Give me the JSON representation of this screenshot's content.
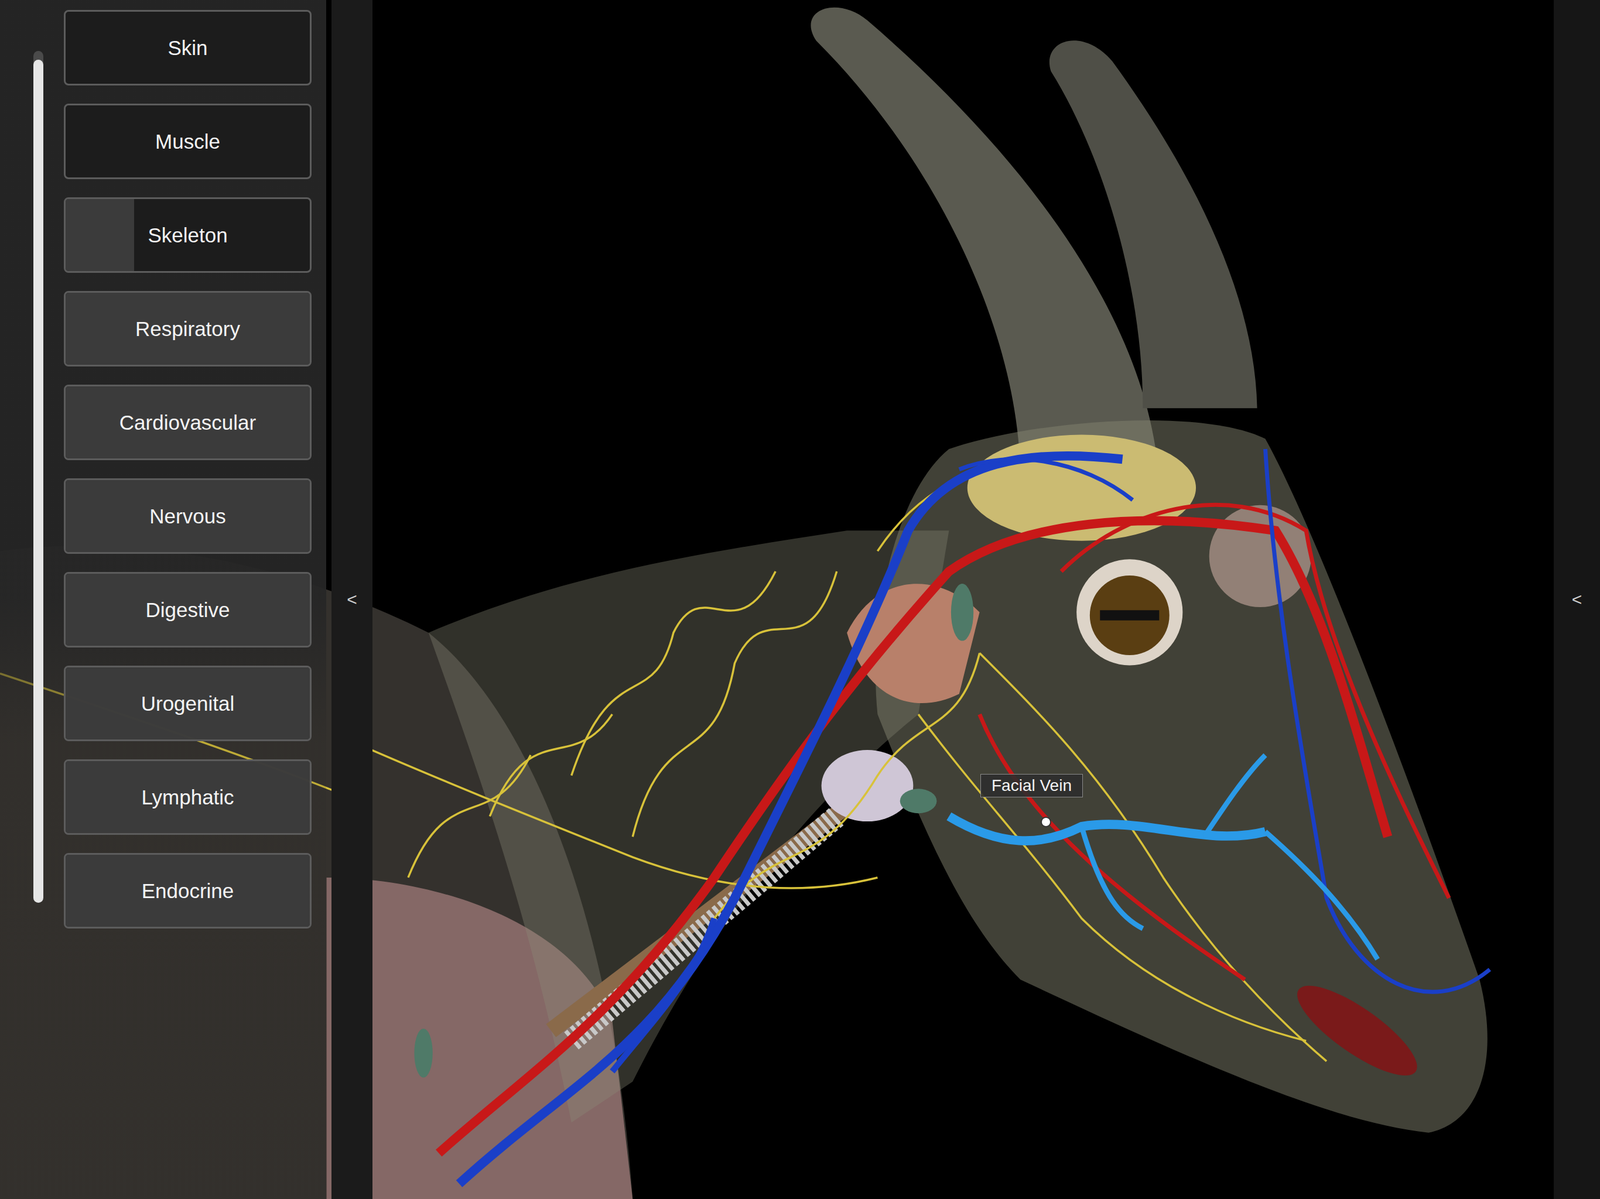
{
  "layers": [
    {
      "label": "Skin",
      "level": 0
    },
    {
      "label": "Muscle",
      "level": 0
    },
    {
      "label": "Skeleton",
      "level": 0.28
    },
    {
      "label": "Respiratory",
      "level": 1
    },
    {
      "label": "Cardiovascular",
      "level": 1
    },
    {
      "label": "Nervous",
      "level": 1
    },
    {
      "label": "Digestive",
      "level": 1
    },
    {
      "label": "Urogenital",
      "level": 1
    },
    {
      "label": "Lymphatic",
      "level": 1
    },
    {
      "label": "Endocrine",
      "level": 1
    }
  ],
  "scrollbar": {
    "level": 0.99
  },
  "collapse_left": "<",
  "collapse_right": "<",
  "selection_label": {
    "text": "Facial Vein"
  }
}
